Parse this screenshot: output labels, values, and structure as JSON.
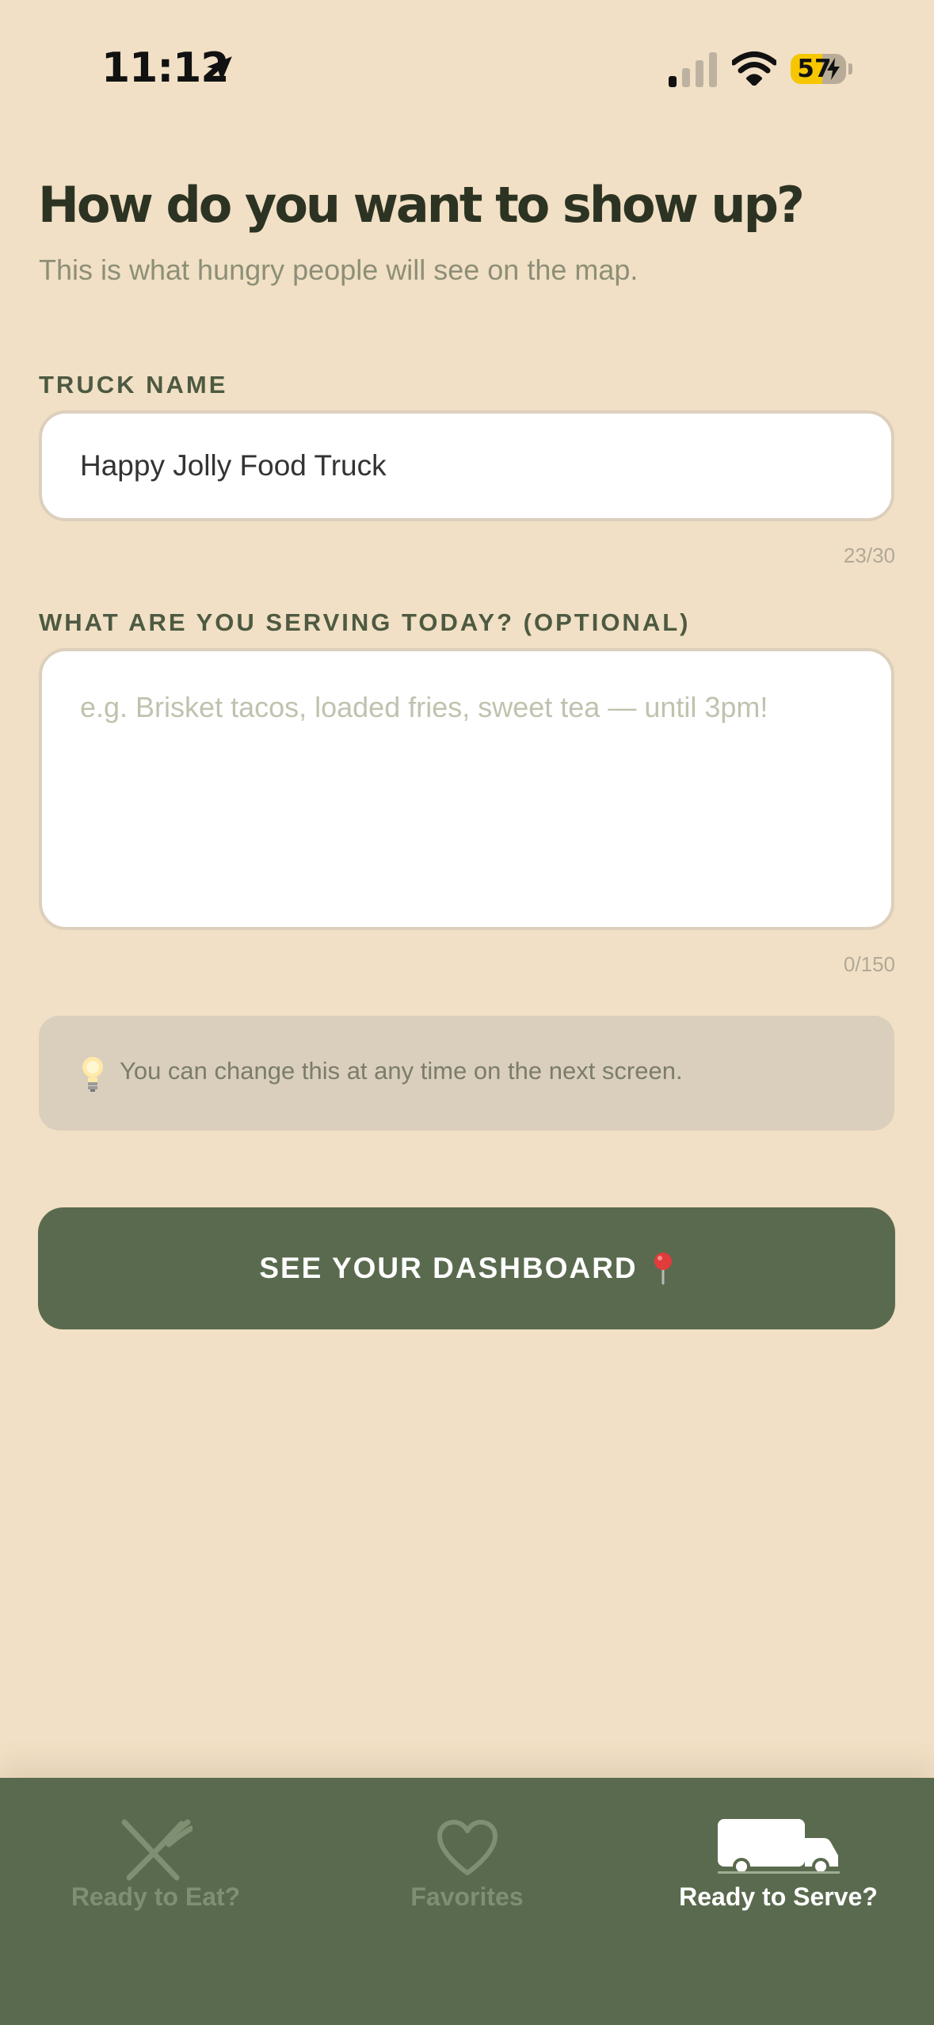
{
  "status_bar": {
    "time": "11:12",
    "battery": "57",
    "battery_level": 0.57,
    "battery_color": "#F6C700"
  },
  "header": {
    "title": "How do you want to show up?",
    "subtitle": "This is what hungry people will see on the map."
  },
  "form": {
    "truck_name_label": "TRUCK NAME",
    "truck_name_value": "Happy Jolly Food Truck",
    "truck_name_counter": "23/30",
    "serving_label": "WHAT ARE YOU SERVING TODAY? (OPTIONAL)",
    "serving_placeholder": "e.g. Brisket tacos, loaded fries, sweet tea — until 3pm!",
    "serving_value": "",
    "serving_counter": "0/150"
  },
  "tip": {
    "icon": "lightbulb-icon",
    "text": "You can change this at any time on the next screen."
  },
  "cta": {
    "label": "SEE YOUR DASHBOARD",
    "icon": "pin-icon",
    "color": "#5A6A4E"
  },
  "tab_bar": {
    "tabs": [
      {
        "label": "Ready to Eat?",
        "icon": "fork-knife-icon",
        "active": false
      },
      {
        "label": "Favorites",
        "icon": "heart-icon",
        "active": false
      },
      {
        "label": "Ready to Serve?",
        "icon": "truck-icon",
        "active": true
      }
    ]
  },
  "colors": {
    "background": "#F1E0C5",
    "accent": "#5A6A4E",
    "title": "#2C3323"
  }
}
